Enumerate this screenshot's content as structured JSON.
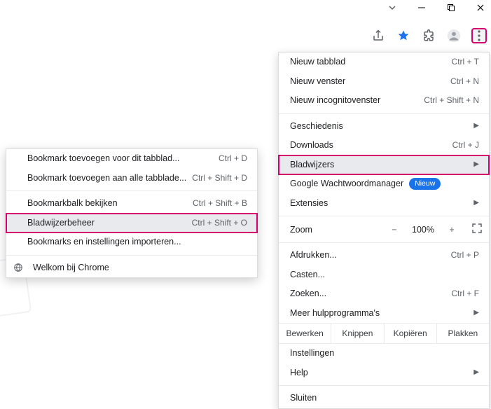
{
  "window_controls": {
    "dropdown_icon": "chevron-down",
    "minimize_icon": "minimize",
    "maximize_icon": "maximize",
    "close_icon": "close"
  },
  "toolbar": {
    "share_icon": "share",
    "star_icon": "star",
    "extensions_icon": "extensions",
    "profile_icon": "profile",
    "menu_icon": "more-vertical"
  },
  "main_menu": {
    "group_basic": [
      {
        "label": "Nieuw tabblad",
        "shortcut": "Ctrl + T"
      },
      {
        "label": "Nieuw venster",
        "shortcut": "Ctrl + N"
      },
      {
        "label": "Nieuw incognitovenster",
        "shortcut": "Ctrl + Shift + N"
      }
    ],
    "group_nav": [
      {
        "label": "Geschiedenis",
        "submenu": true
      },
      {
        "label": "Downloads",
        "shortcut": "Ctrl + J"
      },
      {
        "label": "Bladwijzers",
        "submenu": true,
        "highlighted": true
      },
      {
        "label": "Google Wachtwoordmanager",
        "badge": "Nieuw"
      },
      {
        "label": "Extensies",
        "submenu": true
      }
    ],
    "zoom": {
      "label": "Zoom",
      "minus": "−",
      "value": "100%",
      "plus": "+"
    },
    "group_tools": [
      {
        "label": "Afdrukken...",
        "shortcut": "Ctrl + P"
      },
      {
        "label": "Casten..."
      },
      {
        "label": "Zoeken...",
        "shortcut": "Ctrl + F"
      },
      {
        "label": "Meer hulpprogramma's",
        "submenu": true
      }
    ],
    "edit_row": {
      "edit": "Bewerken",
      "cut": "Knippen",
      "copy": "Kopiëren",
      "paste": "Plakken"
    },
    "group_settings": [
      {
        "label": "Instellingen"
      },
      {
        "label": "Help",
        "submenu": true
      }
    ],
    "exit": {
      "label": "Sluiten"
    }
  },
  "sub_menu": {
    "group1": [
      {
        "label": "Bookmark toevoegen voor dit tabblad...",
        "shortcut": "Ctrl + D"
      },
      {
        "label": "Bookmark toevoegen aan alle tabblade...",
        "shortcut": "Ctrl + Shift + D"
      }
    ],
    "group2": [
      {
        "label": "Bookmarkbalk bekijken",
        "shortcut": "Ctrl + Shift + B"
      },
      {
        "label": "Bladwijzerbeheer",
        "shortcut": "Ctrl + Shift + O",
        "highlighted": true
      },
      {
        "label": "Bookmarks en instellingen importeren..."
      }
    ],
    "group3": [
      {
        "label": "Welkom bij Chrome",
        "icon": "globe"
      }
    ]
  }
}
